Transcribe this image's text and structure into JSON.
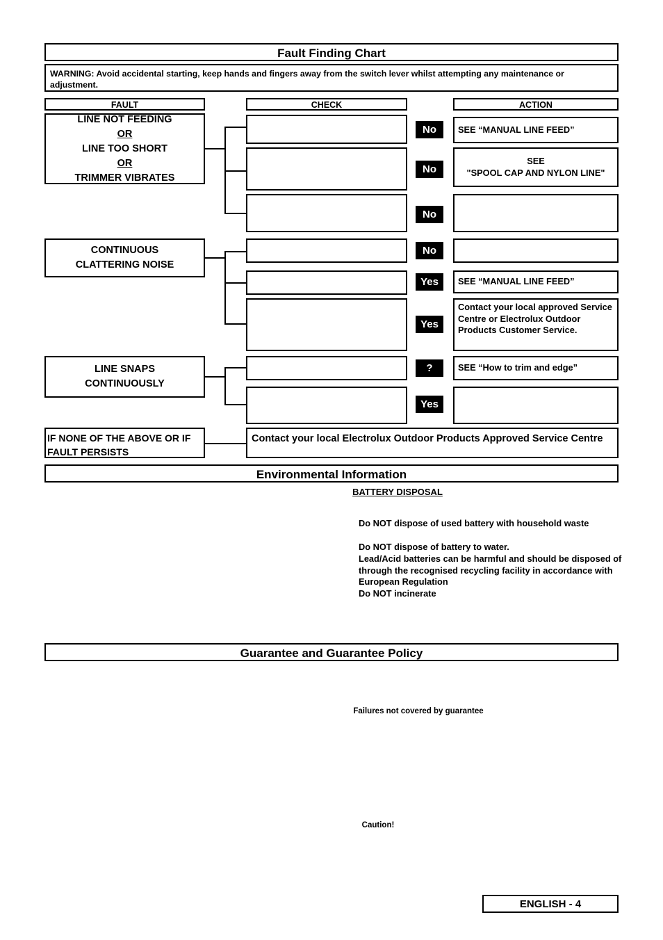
{
  "fault_chart": {
    "title": "Fault Finding Chart",
    "warning": "WARNING:  Avoid accidental starting, keep hands and fingers away from the switch lever whilst attempting any maintenance or adjustment.",
    "columns": {
      "fault": "FAULT",
      "check": "CHECK",
      "action": "ACTION"
    },
    "faults": [
      {
        "lines": [
          "LINE NOT FEEDING",
          "OR",
          "LINE TOO SHORT",
          "OR",
          "TRIMMER VIBRATES"
        ]
      },
      {
        "lines": [
          "CONTINUOUS",
          "CLATTERING NOISE"
        ]
      },
      {
        "lines": [
          "LINE SNAPS",
          "CONTINUOUSLY"
        ]
      }
    ],
    "rows": [
      {
        "check": "",
        "badge": "No",
        "action": "SEE “MANUAL LINE FEED”"
      },
      {
        "check": "",
        "badge": "No",
        "action": "SEE\n\"SPOOL CAP AND NYLON LINE\""
      },
      {
        "check": "",
        "badge": "No",
        "action": ""
      },
      {
        "check": "",
        "badge": "No",
        "action": ""
      },
      {
        "check": "",
        "badge": "Yes",
        "action": "SEE “MANUAL LINE FEED”"
      },
      {
        "check": "",
        "badge": "Yes",
        "action": "Contact your local approved Service Centre or Electrolux Outdoor Products Customer Service."
      },
      {
        "check": "",
        "badge": "?",
        "action": "SEE “How to trim and edge”"
      },
      {
        "check": "",
        "badge": "Yes",
        "action": ""
      }
    ],
    "bottom_left": "IF NONE OF THE ABOVE OR IF FAULT PERSISTS",
    "bottom_right": "Contact your local Electrolux Outdoor Products Approved Service Centre"
  },
  "environmental": {
    "title": "Environmental Information",
    "subtitle": "BATTERY DISPOSAL",
    "paragraphs": [
      "Do NOT dispose of used battery with household waste",
      "Do NOT dispose of battery to water.",
      "Lead/Acid batteries can be harmful and should be disposed of through the recognised recycling facility in accordance with European Regulation",
      "Do NOT incinerate"
    ]
  },
  "guarantee": {
    "title": "Guarantee and Guarantee Policy",
    "note": "Failures not covered by guarantee",
    "caution": "Caution!"
  },
  "footer": {
    "page_label": "ENGLISH - 4"
  }
}
